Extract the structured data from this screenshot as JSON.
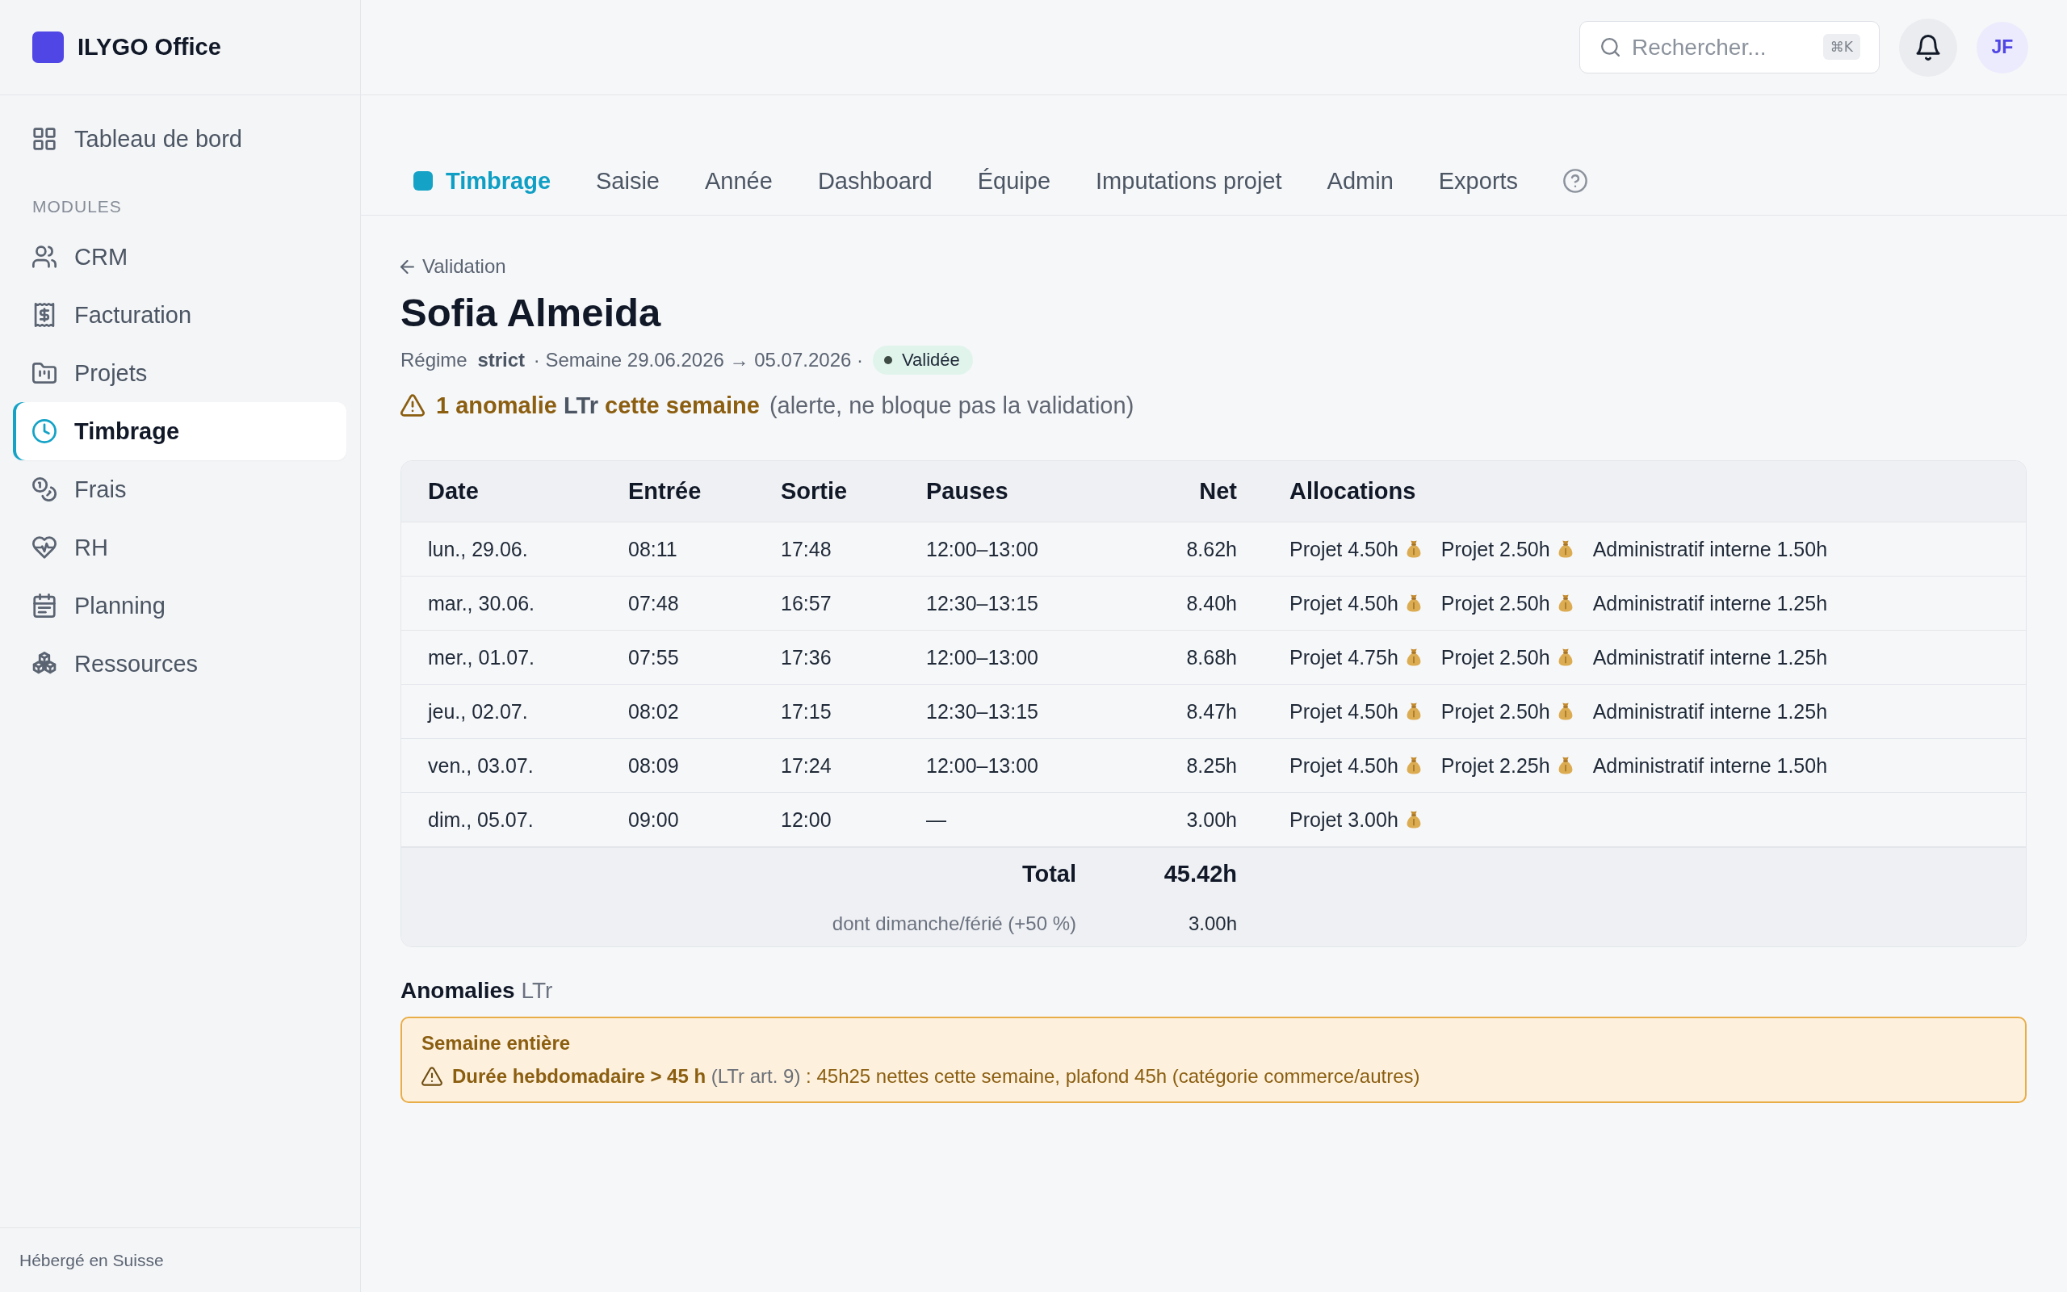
{
  "sidebar": {
    "brand": "ILYGO Office",
    "top_items": [
      {
        "label": "Tableau de bord",
        "selected": false
      }
    ],
    "section_title": "MODULES",
    "items": [
      {
        "label": "CRM",
        "selected": false
      },
      {
        "label": "Facturation",
        "selected": false
      },
      {
        "label": "Projets",
        "selected": false
      },
      {
        "label": "Timbrage",
        "selected": true
      },
      {
        "label": "Frais",
        "selected": false
      },
      {
        "label": "RH",
        "selected": false
      },
      {
        "label": "Planning",
        "selected": false
      },
      {
        "label": "Ressources",
        "selected": false
      }
    ],
    "footer": "Hébergé en Suisse"
  },
  "topbar": {
    "search": {
      "placeholder": "Rechercher...",
      "shortcut": "⌘K"
    },
    "avatar": "JF"
  },
  "tabs": [
    {
      "label": "Timbrage",
      "selected": true
    },
    {
      "label": "Saisie",
      "selected": false
    },
    {
      "label": "Année",
      "selected": false
    },
    {
      "label": "Dashboard",
      "selected": false
    },
    {
      "label": "Équipe",
      "selected": false
    },
    {
      "label": "Imputations projet",
      "selected": false
    },
    {
      "label": "Admin",
      "selected": false
    },
    {
      "label": "Exports",
      "selected": false
    }
  ],
  "header": {
    "back_link": "Validation",
    "title": "Sofia Almeida",
    "meta": "Régime **strict** · Semaine 29.06.2026 → 05.07.2026 ·",
    "status": "Validée",
    "alert": {
      "segments": [
        {
          "kind": "emphasis",
          "text": "1 anomalie"
        },
        {
          "kind": "abbreviation",
          "text": "LTr"
        },
        {
          "kind": "emphasis",
          "text": "cette semaine"
        },
        {
          "kind": "note",
          "text": "(alerte, ne bloque pas la validation)"
        }
      ]
    }
  },
  "table": {
    "columns": [
      "Date",
      "Entrée",
      "Sortie",
      "Pauses",
      "Net",
      "Allocations"
    ],
    "rows": [
      {
        "date": "lun., 29.06.",
        "entry": "08:11",
        "exit": "17:48",
        "pauses": "12:00–13:00",
        "net": "8.62h",
        "allocations": [
          {
            "label": "Projet 4.50h",
            "billable": true
          },
          {
            "label": "Projet 2.50h",
            "billable": true
          },
          {
            "label": "Administratif interne 1.50h",
            "billable": false
          }
        ]
      },
      {
        "date": "mar., 30.06.",
        "entry": "07:48",
        "exit": "16:57",
        "pauses": "12:30–13:15",
        "net": "8.40h",
        "allocations": [
          {
            "label": "Projet 4.50h",
            "billable": true
          },
          {
            "label": "Projet 2.50h",
            "billable": true
          },
          {
            "label": "Administratif interne 1.25h",
            "billable": false
          }
        ]
      },
      {
        "date": "mer., 01.07.",
        "entry": "07:55",
        "exit": "17:36",
        "pauses": "12:00–13:00",
        "net": "8.68h",
        "allocations": [
          {
            "label": "Projet 4.75h",
            "billable": true
          },
          {
            "label": "Projet 2.50h",
            "billable": true
          },
          {
            "label": "Administratif interne 1.25h",
            "billable": false
          }
        ]
      },
      {
        "date": "jeu., 02.07.",
        "entry": "08:02",
        "exit": "17:15",
        "pauses": "12:30–13:15",
        "net": "8.47h",
        "allocations": [
          {
            "label": "Projet 4.50h",
            "billable": true
          },
          {
            "label": "Projet 2.50h",
            "billable": true
          },
          {
            "label": "Administratif interne 1.25h",
            "billable": false
          }
        ]
      },
      {
        "date": "ven., 03.07.",
        "entry": "08:09",
        "exit": "17:24",
        "pauses": "12:00–13:00",
        "net": "8.25h",
        "allocations": [
          {
            "label": "Projet 4.50h",
            "billable": true
          },
          {
            "label": "Projet 2.25h",
            "billable": true
          },
          {
            "label": "Administratif interne 1.50h",
            "billable": false
          }
        ]
      },
      {
        "date": "dim., 05.07.",
        "entry": "09:00",
        "exit": "12:00",
        "pauses": "—",
        "net": "3.00h",
        "allocations": [
          {
            "label": "Projet 3.00h",
            "billable": true
          }
        ]
      }
    ],
    "totals": [
      {
        "kind": "total",
        "label": "Total",
        "value": "45.42h"
      },
      {
        "kind": "note",
        "label": "dont dimanche/férié (+50 %)",
        "value": "3.00h"
      }
    ]
  },
  "anomalies": {
    "title": "Anomalies",
    "title_suffix": "LTr",
    "items": [
      {
        "scope": "Semaine entière",
        "rule": "Durée hebdomadaire > 45 h",
        "reference": "(LTr art. 9)",
        "detail": ": 45h25 nettes cette semaine, plafond 45h (catégorie commerce/autres)"
      }
    ]
  }
}
